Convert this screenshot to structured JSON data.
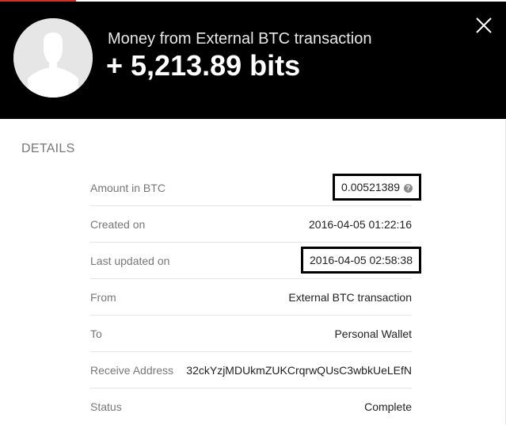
{
  "header": {
    "title": "Money from External BTC transaction",
    "amount": "+ 5,213.89 bits"
  },
  "details": {
    "heading": "DETAILS",
    "rows": [
      {
        "label": "Amount in BTC",
        "value": "0.00521389"
      },
      {
        "label": "Created on",
        "value": "2016-04-05 01:22:16"
      },
      {
        "label": "Last updated on",
        "value": "2016-04-05 02:58:38"
      },
      {
        "label": "From",
        "value": "External BTC transaction"
      },
      {
        "label": "To",
        "value": "Personal Wallet"
      },
      {
        "label": "Receive Address",
        "value": "32ckYzjMDUkmZUKCrqrwQUsC3wbkUeLEfN"
      },
      {
        "label": "Status",
        "value": "Complete"
      }
    ],
    "info_icon_glyph": "?"
  },
  "colors": {
    "header_bg": "#000000",
    "accent": "#d0302a",
    "label_gray": "#777777"
  },
  "icons": [
    "user-avatar-icon",
    "close-icon",
    "info-icon"
  ]
}
